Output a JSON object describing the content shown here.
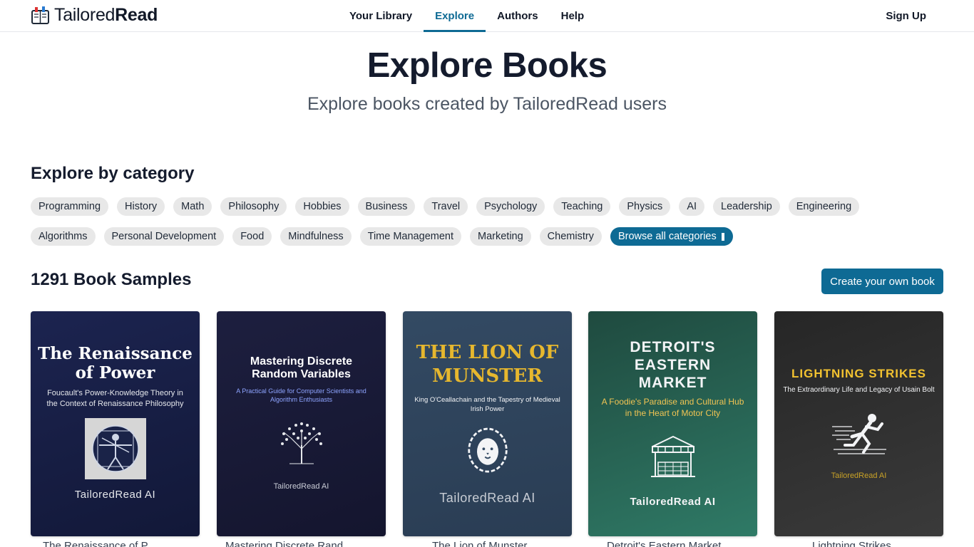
{
  "header": {
    "brand_light": "Tailored",
    "brand_bold": "Read",
    "nav": [
      {
        "label": "Your Library",
        "active": false
      },
      {
        "label": "Explore",
        "active": true
      },
      {
        "label": "Authors",
        "active": false
      },
      {
        "label": "Help",
        "active": false
      }
    ],
    "signup": "Sign Up"
  },
  "hero": {
    "title": "Explore Books",
    "subtitle": "Explore books created by TailoredRead users"
  },
  "categories": {
    "heading": "Explore by category",
    "row1": [
      "Programming",
      "History",
      "Math",
      "Philosophy",
      "Hobbies",
      "Business",
      "Travel",
      "Psychology",
      "Teaching",
      "Physics",
      "AI",
      "Leadership",
      "Engineering"
    ],
    "row2": [
      "Algorithms",
      "Personal Development",
      "Food",
      "Mindfulness",
      "Time Management",
      "Marketing",
      "Chemistry"
    ],
    "browse_all": "Browse all categories"
  },
  "samples": {
    "heading": "1291 Book Samples",
    "create_button": "Create your own book"
  },
  "books": [
    {
      "cover_title": "The Renaissance of Power",
      "cover_subtitle": "Foucault's Power-Knowledge Theory in the Context of Renaissance Philosophy",
      "brand": "TailoredRead AI",
      "art_icon": "vitruvian-man-icon",
      "caption": "The Renaissance of P..."
    },
    {
      "cover_title": "Mastering Discrete Random Variables",
      "cover_subtitle": "A Practical Guide for Computer Scientists and Algorithm Enthusiasts",
      "brand": "TailoredRead AI",
      "art_icon": "tree-icon",
      "caption": "Mastering Discrete Rand..."
    },
    {
      "cover_title": "THE LION OF MUNSTER",
      "cover_subtitle": "King O'Ceallachain and the Tapestry of Medieval Irish Power",
      "brand": "TailoredRead AI",
      "art_icon": "lion-icon",
      "caption": "The Lion of Munster"
    },
    {
      "cover_title": "DETROIT'S EASTERN MARKET",
      "cover_subtitle": "A Foodie's Paradise and Cultural Hub in the Heart of Motor City",
      "brand": "TailoredRead AI",
      "art_icon": "market-stall-icon",
      "caption": "Detroit's Eastern Market"
    },
    {
      "cover_title": "LIGHTNING STRIKES",
      "cover_subtitle": "The Extraordinary Life and Legacy of Usain Bolt",
      "brand": "TailoredRead AI",
      "art_icon": "sprinter-icon",
      "caption": "Lightning Strikes"
    }
  ],
  "colors": {
    "accent": "#0e6a94",
    "chip_bg": "#e8e8e8",
    "gold": "#e6b72e"
  }
}
